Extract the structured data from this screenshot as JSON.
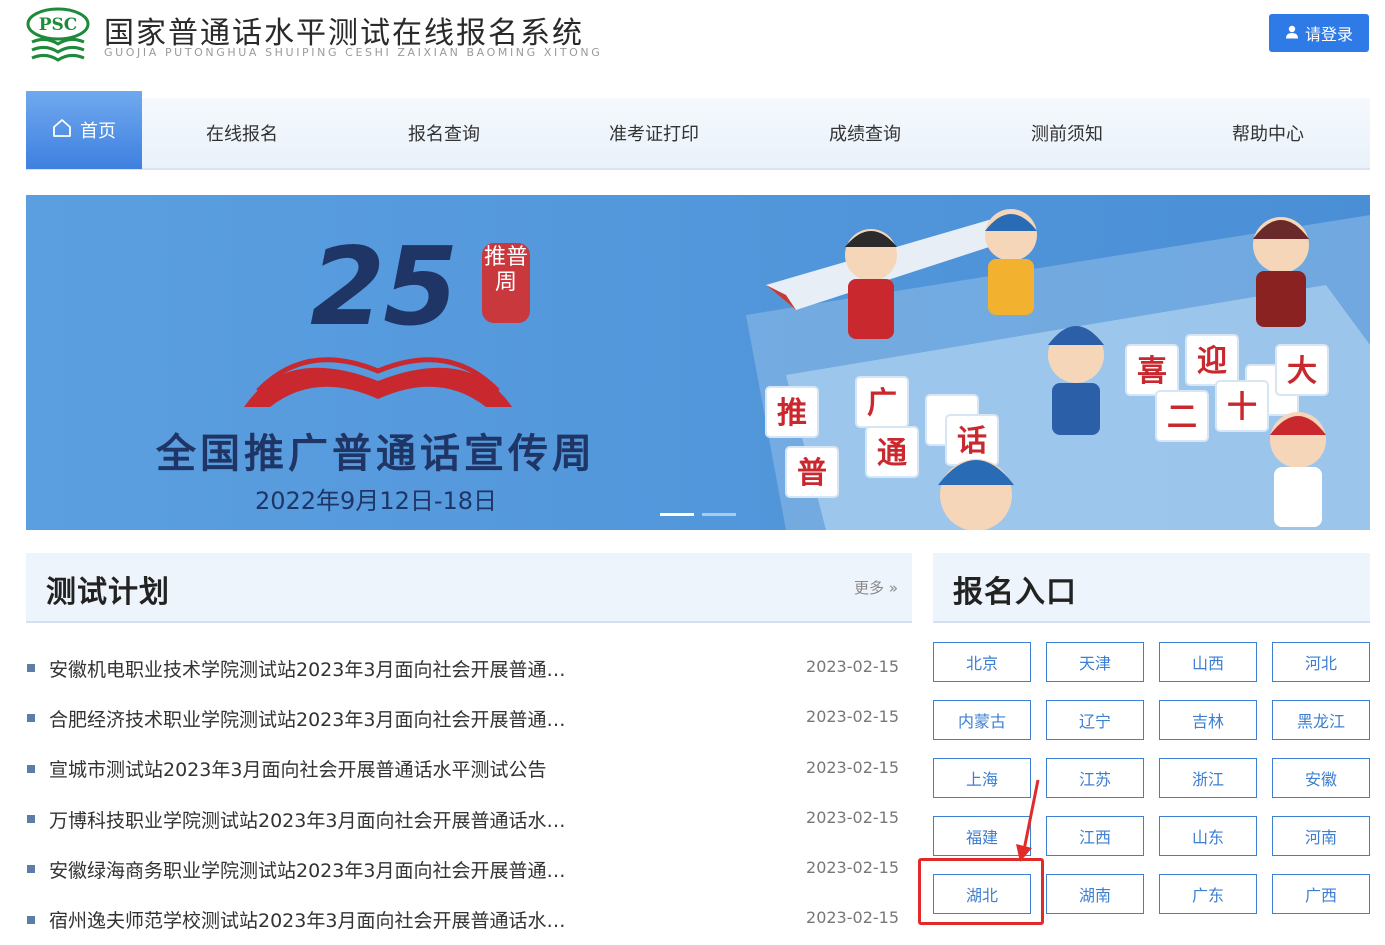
{
  "header": {
    "title": "国家普通话水平测试在线报名系统",
    "subtitle": "GUOJIA PUTONGHUA SHUIPING CESHI ZAIXIAN BAOMING XITONG",
    "logo_text": "PSC",
    "login_label": "请登录"
  },
  "nav": {
    "items": [
      "首页",
      "在线报名",
      "报名查询",
      "准考证打印",
      "成绩查询",
      "测前须知",
      "帮助中心"
    ]
  },
  "banner": {
    "number": "25",
    "seal": "推普周",
    "title": "全国推广普通话宣传周",
    "date": "2022年9月12日-18日",
    "tiles": [
      "推",
      "广",
      "普",
      "通",
      "话",
      "喜",
      "迎",
      "二",
      "十",
      "大"
    ]
  },
  "plan": {
    "title": "测试计划",
    "more": "更多 »",
    "items": [
      {
        "text": "安徽机电职业技术学院测试站2023年3月面向社会开展普通…",
        "date": "2023-02-15"
      },
      {
        "text": "合肥经济技术职业学院测试站2023年3月面向社会开展普通…",
        "date": "2023-02-15"
      },
      {
        "text": "宣城市测试站2023年3月面向社会开展普通话水平测试公告",
        "date": "2023-02-15"
      },
      {
        "text": "万博科技职业学院测试站2023年3月面向社会开展普通话水…",
        "date": "2023-02-15"
      },
      {
        "text": "安徽绿海商务职业学院测试站2023年3月面向社会开展普通…",
        "date": "2023-02-15"
      },
      {
        "text": "宿州逸夫师范学校测试站2023年3月面向社会开展普通话水…",
        "date": "2023-02-15"
      }
    ]
  },
  "registration": {
    "title": "报名入口",
    "provinces": [
      "北京",
      "天津",
      "山西",
      "河北",
      "内蒙古",
      "辽宁",
      "吉林",
      "黑龙江",
      "上海",
      "江苏",
      "浙江",
      "安徽",
      "福建",
      "江西",
      "山东",
      "河南",
      "湖北",
      "湖南",
      "广东",
      "广西"
    ],
    "highlighted": "湖北"
  },
  "colors": {
    "accent": "#2e7ae6",
    "province_border": "#3d7fd1",
    "highlight": "#e12a2a",
    "banner_bg": "#4d93d8",
    "banner_text": "#1f3566"
  },
  "icons": {
    "login": "user-icon",
    "home": "home-icon",
    "more": "double-chevron-right-icon"
  }
}
